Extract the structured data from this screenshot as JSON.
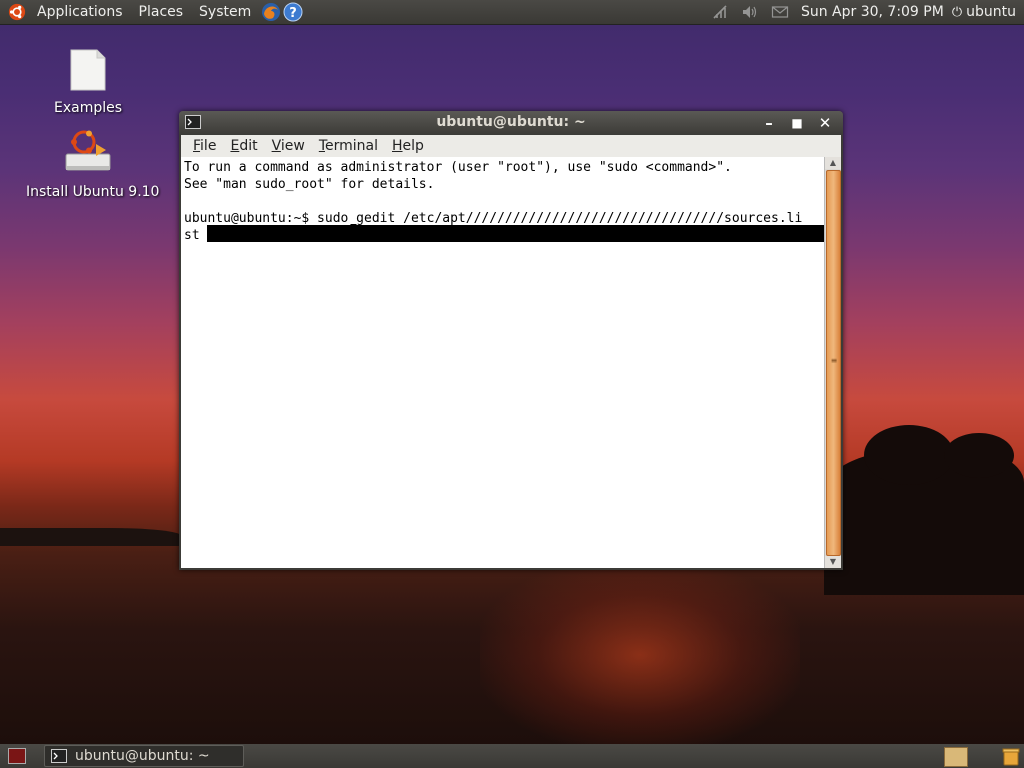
{
  "top_panel": {
    "menus": [
      "Applications",
      "Places",
      "System"
    ],
    "clock": "Sun Apr 30,  7:09 PM",
    "user": "ubuntu"
  },
  "desktop": {
    "icons": [
      {
        "label": "Examples",
        "icon": "document-icon"
      },
      {
        "label": "Install Ubuntu 9.10",
        "icon": "install-icon"
      }
    ]
  },
  "terminal_window": {
    "title": "ubuntu@ubuntu: ~",
    "menus": [
      {
        "accel": "F",
        "rest": "ile"
      },
      {
        "accel": "E",
        "rest": "dit"
      },
      {
        "accel": "V",
        "rest": "iew"
      },
      {
        "accel": "T",
        "rest": "erminal"
      },
      {
        "accel": "H",
        "rest": "elp"
      }
    ],
    "lines": [
      "To run a command as administrator (user \"root\"), use \"sudo <command>\".",
      "See \"man sudo_root\" for details.",
      "",
      "ubuntu@ubuntu:~$ sudo gedit /etc/apt/////////////////////////////////sources.li",
      "st "
    ]
  },
  "bottom_panel": {
    "task_label": "ubuntu@ubuntu: ~"
  },
  "colors": {
    "panel": "#3c3b37",
    "scroll_thumb": "#e59c54",
    "terminal_bg": "#ffffff"
  }
}
